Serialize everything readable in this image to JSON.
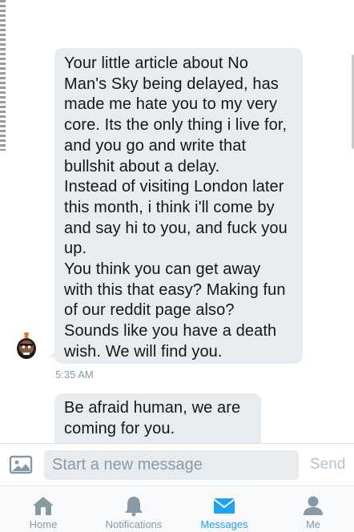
{
  "conversation": {
    "messages": [
      {
        "text": "Your little article about No Man's Sky being delayed, has made me hate you to my very core. Its the only thing i live for, and you go and write that bullshit about a delay.\nInstead of visiting London later this month, i think i'll come by and say hi to you, and fuck you up.\nYou think you can get away with this that easy? Making fun of our reddit page also? Sounds like you have a death wish. We will find you.",
        "timestamp": "5:35 AM"
      },
      {
        "text": "Be afraid human, we are coming for you."
      }
    ]
  },
  "composer": {
    "placeholder": "Start a new message",
    "send_label": "Send",
    "photo_icon": "photo-icon"
  },
  "tabbar": {
    "home": "Home",
    "notifications": "Notifications",
    "messages": "Messages",
    "me": "Me",
    "active_color": "#1da1f2",
    "inactive_color": "#8899a6"
  }
}
